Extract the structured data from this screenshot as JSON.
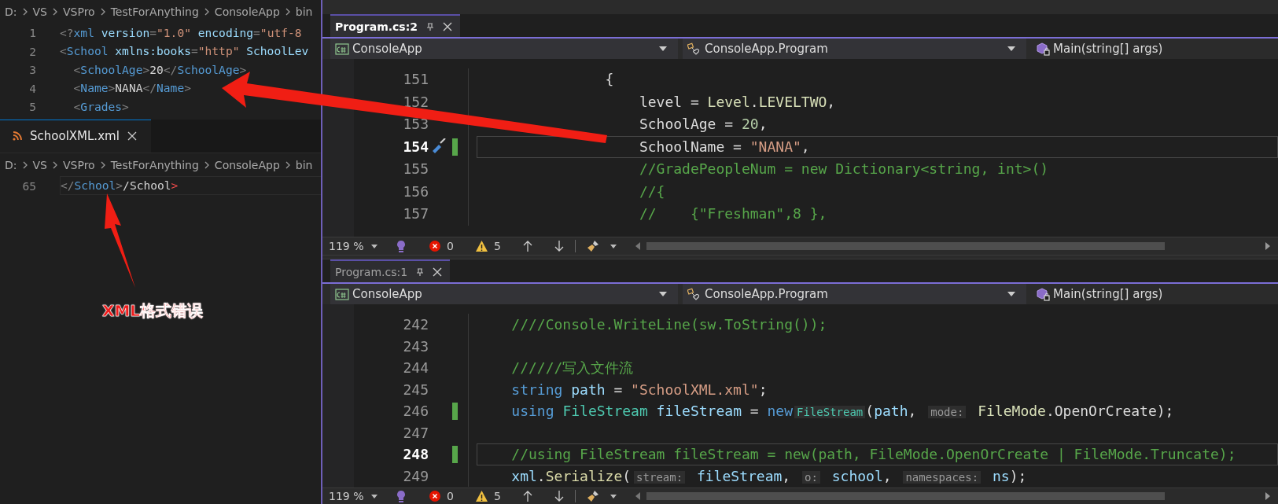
{
  "xml_top": {
    "breadcrumb": [
      "D:",
      "VS",
      "VSPro",
      "TestForAnything",
      "ConsoleApp",
      "bin"
    ],
    "lines": [
      {
        "number": "1",
        "current": false,
        "tokens": [
          {
            "kind": "punct",
            "text": "<?"
          },
          {
            "kind": "tag",
            "text": "xml"
          },
          {
            "kind": "attr",
            "text": " version"
          },
          {
            "kind": "punct",
            "text": "="
          },
          {
            "kind": "string",
            "text": "\"1.0\""
          },
          {
            "kind": "attr",
            "text": " encoding"
          },
          {
            "kind": "punct",
            "text": "="
          },
          {
            "kind": "string",
            "text": "\"utf-8"
          }
        ]
      },
      {
        "number": "2",
        "current": false,
        "tokens": [
          {
            "kind": "punct",
            "text": "<"
          },
          {
            "kind": "tag",
            "text": "School"
          },
          {
            "kind": "attr",
            "text": " xmlns:books"
          },
          {
            "kind": "punct",
            "text": "="
          },
          {
            "kind": "string",
            "text": "\"http\""
          },
          {
            "kind": "attr",
            "text": " SchoolLev"
          }
        ]
      },
      {
        "number": "3",
        "current": false,
        "tokens": [
          {
            "kind": "punct",
            "text": "  <"
          },
          {
            "kind": "tag",
            "text": "SchoolAge"
          },
          {
            "kind": "punct",
            "text": ">"
          },
          {
            "kind": "text",
            "text": "20"
          },
          {
            "kind": "punct",
            "text": "</"
          },
          {
            "kind": "tag",
            "text": "SchoolAge"
          },
          {
            "kind": "punct",
            "text": ">"
          }
        ]
      },
      {
        "number": "4",
        "current": false,
        "tokens": [
          {
            "kind": "punct",
            "text": "  <"
          },
          {
            "kind": "tag",
            "text": "Name"
          },
          {
            "kind": "punct",
            "text": ">"
          },
          {
            "kind": "text",
            "text": "NANA"
          },
          {
            "kind": "punct",
            "text": "</"
          },
          {
            "kind": "tag",
            "text": "Name"
          },
          {
            "kind": "punct",
            "text": ">"
          }
        ]
      },
      {
        "number": "5",
        "current": false,
        "tokens": [
          {
            "kind": "punct",
            "text": "  <"
          },
          {
            "kind": "tag",
            "text": "Grades"
          },
          {
            "kind": "punct",
            "text": ">"
          }
        ]
      }
    ]
  },
  "xml_tab": {
    "label": "SchoolXML.xml",
    "selected": true
  },
  "xml_bottom": {
    "breadcrumb": [
      "D:",
      "VS",
      "VSPro",
      "TestForAnything",
      "ConsoleApp",
      "bin"
    ],
    "lines": [
      {
        "number": "65",
        "current": true,
        "tokens": [
          {
            "kind": "punct",
            "text": "</"
          },
          {
            "kind": "tag",
            "text": "School"
          },
          {
            "kind": "punct",
            "text": ">"
          },
          {
            "kind": "text",
            "text": "/School"
          },
          {
            "kind": "error",
            "text": ">"
          }
        ]
      }
    ]
  },
  "annotations": [
    {
      "text": "XML格式错误"
    }
  ],
  "editors": [
    {
      "tab": {
        "label": "Program.cs:2",
        "selected": true
      },
      "nav": [
        "ConsoleApp",
        "ConsoleApp.Program",
        "Main(string[] args)"
      ],
      "lines": [
        {
          "number": "151",
          "current": false,
          "changed": false,
          "quick_action": false,
          "tokens": [
            {
              "kind": "plain",
              "text": "               {"
            }
          ]
        },
        {
          "number": "152",
          "current": false,
          "changed": false,
          "quick_action": false,
          "tokens": [
            {
              "kind": "plain",
              "text": "                   level = "
            },
            {
              "kind": "enum",
              "text": "Level"
            },
            {
              "kind": "plain",
              "text": "."
            },
            {
              "kind": "enum",
              "text": "LEVELTWO"
            },
            {
              "kind": "plain",
              "text": ","
            }
          ]
        },
        {
          "number": "153",
          "current": false,
          "changed": false,
          "quick_action": false,
          "tokens": [
            {
              "kind": "plain",
              "text": "                   SchoolAge = "
            },
            {
              "kind": "number",
              "text": "20"
            },
            {
              "kind": "plain",
              "text": ","
            }
          ]
        },
        {
          "number": "154",
          "current": true,
          "changed": true,
          "quick_action": true,
          "tokens": [
            {
              "kind": "plain",
              "text": "                   SchoolName = "
            },
            {
              "kind": "string",
              "text": "\"NANA\""
            },
            {
              "kind": "plain",
              "text": ","
            }
          ]
        },
        {
          "number": "155",
          "current": false,
          "changed": false,
          "quick_action": false,
          "tokens": [
            {
              "kind": "comment",
              "text": "                   //GradePeopleNum = new Dictionary<string, int>()"
            }
          ]
        },
        {
          "number": "156",
          "current": false,
          "changed": false,
          "quick_action": false,
          "tokens": [
            {
              "kind": "comment",
              "text": "                   //{"
            }
          ]
        },
        {
          "number": "157",
          "current": false,
          "changed": false,
          "quick_action": false,
          "tokens": [
            {
              "kind": "comment",
              "text": "                   //    {\"Freshman\",8 },"
            }
          ]
        }
      ],
      "status": {
        "zoom": "119 %",
        "errors": "0",
        "warnings": "5"
      }
    },
    {
      "tab": {
        "label": "Program.cs:1",
        "selected": false
      },
      "nav": [
        "ConsoleApp",
        "ConsoleApp.Program",
        "Main(string[] args)"
      ],
      "lines": [
        {
          "number": "242",
          "current": false,
          "changed": false,
          "quick_action": false,
          "tokens": [
            {
              "kind": "comment",
              "text": "    ////Console.WriteLine(sw.ToString());"
            }
          ]
        },
        {
          "number": "243",
          "current": false,
          "changed": false,
          "quick_action": false
        },
        {
          "number": "244",
          "current": false,
          "changed": false,
          "quick_action": false,
          "tokens": [
            {
              "kind": "comment",
              "text": "    //////写入文件流"
            }
          ]
        },
        {
          "number": "245",
          "current": false,
          "changed": false,
          "quick_action": false,
          "tokens": [
            {
              "kind": "keyword",
              "text": "    string"
            },
            {
              "kind": "variable",
              "text": " path"
            },
            {
              "kind": "plain",
              "text": " = "
            },
            {
              "kind": "string",
              "text": "\"SchoolXML.xml\""
            },
            {
              "kind": "plain",
              "text": ";"
            }
          ]
        },
        {
          "number": "246",
          "current": false,
          "changed": true,
          "quick_action": false,
          "tokens": [
            {
              "kind": "keyword",
              "text": "    using"
            },
            {
              "kind": "type",
              "text": " FileStream"
            },
            {
              "kind": "variable",
              "text": " fileStream"
            },
            {
              "kind": "plain",
              "text": " = "
            },
            {
              "kind": "keyword",
              "text": "new"
            },
            {
              "kind": "hint_type",
              "text": "FileStream"
            },
            {
              "kind": "plain",
              "text": "("
            },
            {
              "kind": "variable",
              "text": "path"
            },
            {
              "kind": "plain",
              "text": ", "
            },
            {
              "kind": "hint",
              "text": "mode:"
            },
            {
              "kind": "enum",
              "text": " FileMode"
            },
            {
              "kind": "plain",
              "text": ".OpenOrCreate);"
            }
          ]
        },
        {
          "number": "247",
          "current": false,
          "changed": false,
          "quick_action": false
        },
        {
          "number": "248",
          "current": true,
          "changed": true,
          "quick_action": false,
          "tokens": [
            {
              "kind": "comment",
              "text": "    //using FileStream fileStream = new(path, FileMode.OpenOrCreate | FileMode.Truncate);"
            }
          ]
        },
        {
          "number": "249",
          "current": false,
          "changed": false,
          "quick_action": false,
          "tokens": [
            {
              "kind": "variable",
              "text": "    xml"
            },
            {
              "kind": "plain",
              "text": "."
            },
            {
              "kind": "method",
              "text": "Serialize"
            },
            {
              "kind": "plain",
              "text": "("
            },
            {
              "kind": "hint",
              "text": "stream:"
            },
            {
              "kind": "variable",
              "text": " fileStream"
            },
            {
              "kind": "plain",
              "text": ", "
            },
            {
              "kind": "hint",
              "text": "o:"
            },
            {
              "kind": "variable",
              "text": " school"
            },
            {
              "kind": "plain",
              "text": ", "
            },
            {
              "kind": "hint",
              "text": "namespaces:"
            },
            {
              "kind": "variable",
              "text": " ns"
            },
            {
              "kind": "plain",
              "text": ");"
            }
          ]
        }
      ],
      "status": {
        "zoom": "119 %",
        "errors": "0",
        "warnings": "5"
      }
    }
  ]
}
